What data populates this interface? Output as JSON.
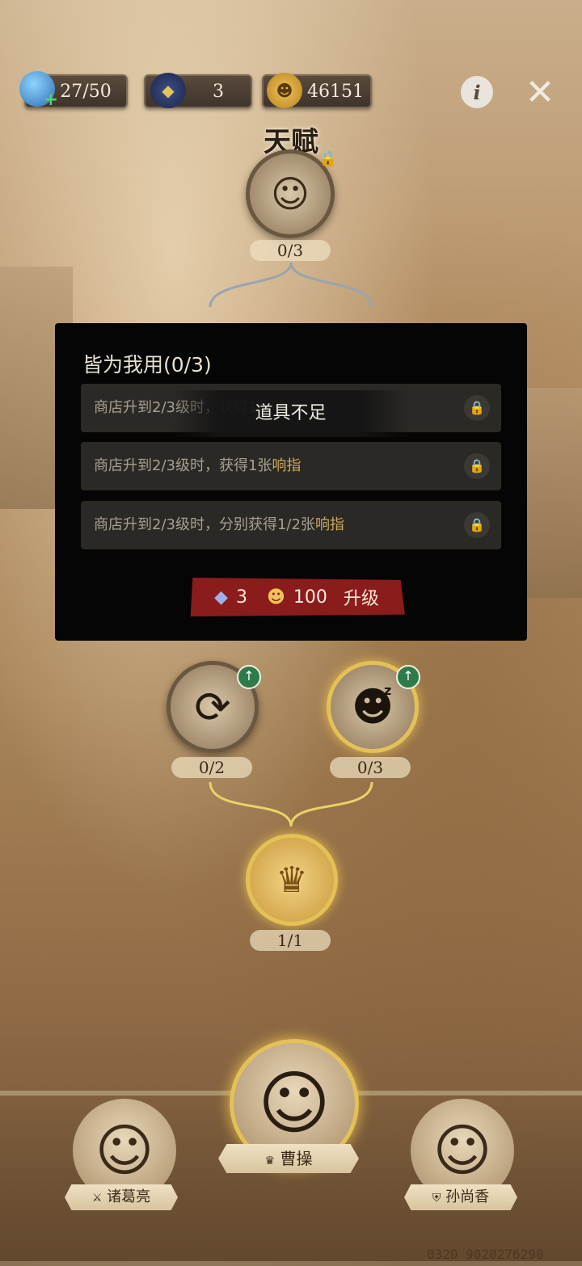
{
  "hud": {
    "energy": "27/50",
    "cat_currency": "3",
    "gold": "46151"
  },
  "icons": {
    "potion": "potion-icon",
    "cat": "cat-icon",
    "coin": "pumpkin-coin-icon",
    "info": "info-icon",
    "close": "close-icon"
  },
  "title": "天赋",
  "tree": {
    "top_count": "0/3",
    "left_count": "0/2",
    "right_count": "0/3",
    "bottom_count": "1/1"
  },
  "popup": {
    "title": "皆为我用(0/3)",
    "rows": [
      {
        "text_a": "商店升到2/3级时，获得1张",
        "highlight": "响指"
      },
      {
        "text_a": "商店升到2/3级时，获得1张",
        "highlight": "响指"
      },
      {
        "text_a": "商店升到2/3级时，分别获得1/2张",
        "highlight": "响指"
      }
    ],
    "toast": "道具不足",
    "cost_cat": "3",
    "cost_gold": "100",
    "upgrade_label": "升级"
  },
  "heroes": {
    "left": "诸葛亮",
    "center": "曹操",
    "right": "孙尚香"
  },
  "watermark": "0320 9020276290",
  "colors": {
    "accent_red": "#8b1c1c",
    "gold_ring": "#e4c158",
    "popup_bg": "#050505"
  }
}
